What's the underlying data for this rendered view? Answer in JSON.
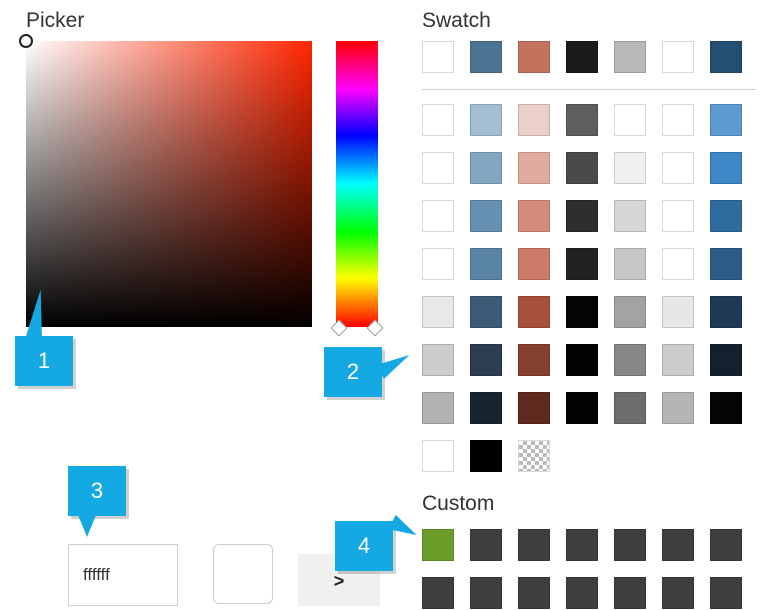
{
  "picker": {
    "title": "Picker"
  },
  "swatch": {
    "title": "Swatch",
    "top_row": [
      "#ffffff",
      "#4d7393",
      "#c3735d",
      "#1a1a1a",
      "#b8b8b8",
      "#ffffff",
      "#234f73"
    ],
    "grid": [
      [
        "#ffffff",
        "#a3bdd3",
        "#ecd0cb",
        "#5e5e5e",
        "#ffffff",
        "#ffffff",
        "#5c9ad0"
      ],
      [
        "#ffffff",
        "#83a7c1",
        "#e1aa9f",
        "#4a4a4a",
        "#f0f0f0",
        "#ffffff",
        "#3d87c6"
      ],
      [
        "#ffffff",
        "#6590b1",
        "#d38b7b",
        "#2d2d2d",
        "#d6d6d6",
        "#ffffff",
        "#2f6c9e"
      ],
      [
        "#ffffff",
        "#5a84a4",
        "#cc7b69",
        "#222222",
        "#c7c7c7",
        "#ffffff",
        "#2b5c87"
      ],
      [
        "#e8e8e8",
        "#3c5b76",
        "#a7503c",
        "#050505",
        "#a3a3a3",
        "#e7e7e7",
        "#1f3a55"
      ],
      [
        "#cdcdcd",
        "#2c3e50",
        "#853f2f",
        "#030303",
        "#878787",
        "#cccccc",
        "#13202e"
      ],
      [
        "#b2b2b2",
        "#172530",
        "#5e2a1f",
        "#020202",
        "#6c6c6c",
        "#b5b5b5",
        "#050505"
      ],
      [
        "#ffffff",
        "#000000",
        "checker"
      ]
    ]
  },
  "custom": {
    "title": "Custom",
    "row1": [
      "#6b9d2b",
      "#3e3e3e",
      "#3e3e3e",
      "#3e3e3e",
      "#3e3e3e",
      "#3e3e3e",
      "#3e3e3e"
    ],
    "row2": [
      "#3e3e3e",
      "#3e3e3e",
      "#3e3e3e",
      "#3e3e3e",
      "#3e3e3e",
      "#3e3e3e",
      "#3e3e3e"
    ]
  },
  "controls": {
    "hex_value": "ffffff",
    "preview_color": "#ffffff",
    "apply_label": ">"
  },
  "callouts": [
    "1",
    "2",
    "3",
    "4"
  ],
  "colors": {
    "callout_blue": "#14a9e3",
    "hue_base": "#ff2600"
  }
}
